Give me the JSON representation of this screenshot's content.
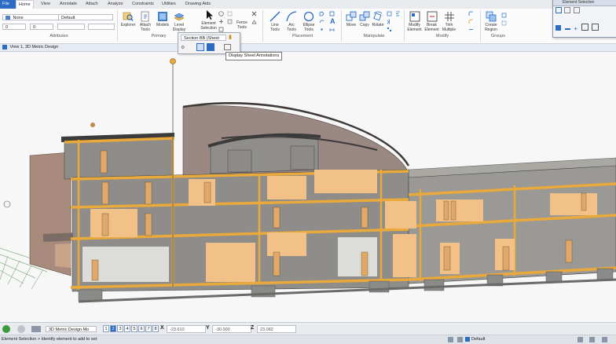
{
  "tabs": [
    "File",
    "Home",
    "View",
    "Annotate",
    "Attach",
    "Analyze",
    "Constraints",
    "Utilities",
    "Drawing Aids"
  ],
  "attributes": {
    "level_value": "None",
    "style_value": "Default",
    "color_value": "0",
    "weight_value": "0",
    "group_label": "Attributes"
  },
  "primary": {
    "group_label": "Primary",
    "explorer": "Explorer",
    "attach_tools": "Attach\nTools",
    "models": "Models",
    "level_display": "Level\nDisplay",
    "element_selection": "Element\nSelection",
    "fence_tools": "Fence\nTools"
  },
  "placement": {
    "group_label": "Placement",
    "line_tools": "Line\nTools",
    "arc_tools": "Arc\nTools",
    "ellipse_tools": "Ellipse\nTools"
  },
  "manipulate": {
    "group_label": "Manipulate",
    "move": "Move",
    "copy": "Copy",
    "rotate": "Rotate"
  },
  "modify": {
    "group_label": "Modify",
    "modify_element": "Modify\nElement",
    "break_element": "Break\nElement",
    "trim_multiple": "Trim\nMultiple"
  },
  "groups": {
    "group_label": "Groups",
    "create_region": "Create\nRegion"
  },
  "popup": {
    "section_dropdown": "Section BB (Sheet",
    "tooltip": "Display Sheet Annotations"
  },
  "element_selection_window": {
    "title": "Element Selection"
  },
  "view": {
    "title": "View 1, 3D Metric Design"
  },
  "bottom": {
    "model_dropdown": "3D Metric Design Mo",
    "view_buttons": [
      "1",
      "2",
      "3",
      "4",
      "5",
      "6",
      "7",
      "8"
    ],
    "x_label": "X",
    "x_value": "-23.610",
    "y_label": "Y",
    "y_value": "-30.000",
    "z_label": "Z",
    "z_value": "23.082"
  },
  "status": {
    "prompt": "Element Selection > Identify element to add to set",
    "level": "Default"
  },
  "colors": {
    "accent": "#2b6cc4",
    "slab": "#e9a93b",
    "wall": "#8c8c88",
    "interior": "#f2c187"
  }
}
